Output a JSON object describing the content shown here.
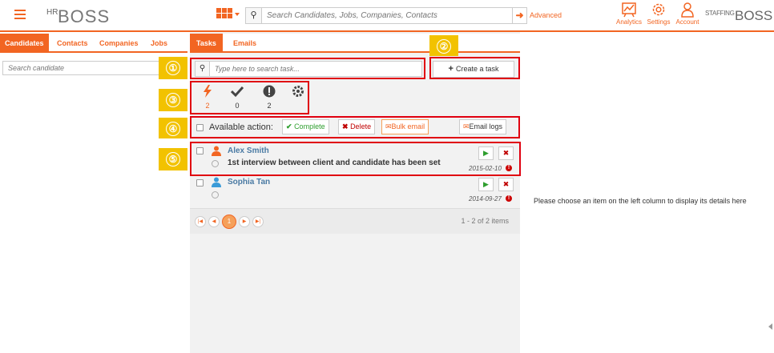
{
  "app": {
    "logo_hr": "HR",
    "logo_boss": "BOSS",
    "staffing_label": "STAFFING",
    "staffing_boss": "BOSS"
  },
  "topbar": {
    "search_placeholder": "Search Candidates, Jobs, Companies, Contacts",
    "advanced_label": "Advanced",
    "nav": [
      {
        "label": "Analytics",
        "icon": "analytics-icon"
      },
      {
        "label": "Settings",
        "icon": "gear-icon"
      },
      {
        "label": "Account",
        "icon": "user-icon"
      }
    ]
  },
  "left": {
    "tabs": [
      "Candidates",
      "Contacts",
      "Companies",
      "Jobs"
    ],
    "active_tab": "Candidates",
    "search_placeholder": "Search candidate"
  },
  "middle": {
    "tabs": [
      "Tasks",
      "Emails"
    ],
    "active_tab": "Tasks",
    "task_search_placeholder": "Type here to search task...",
    "create_task_label": "Create a task",
    "stats": [
      {
        "icon": "bolt-icon",
        "value": "2"
      },
      {
        "icon": "check-icon",
        "value": "0"
      },
      {
        "icon": "exclamation-icon",
        "value": "2"
      },
      {
        "icon": "gear-icon",
        "value": ""
      }
    ],
    "available_action_label": "Available action:",
    "actions": {
      "complete": "Complete",
      "delete": "Delete",
      "bulk_email": "Bulk email",
      "email_logs": "Email logs"
    },
    "tasks": [
      {
        "name": "Alex Smith",
        "description": "1st interview between client and candidate has been set",
        "date": "2015-02-10",
        "person_color": "#f26522"
      },
      {
        "name": "Sophia Tan",
        "description": "",
        "date": "2014-09-27",
        "person_color": "#3a9bd8"
      }
    ],
    "pager": {
      "current_page": "1",
      "info": "1 - 2 of 2 items"
    }
  },
  "right": {
    "placeholder_message": "Please choose an item on the left column to display its details here"
  },
  "annotations": [
    "①",
    "②",
    "③",
    "④",
    "⑤"
  ],
  "colors": {
    "accent": "#f26522",
    "annotation_border": "#e00010",
    "annotation_badge": "#f2c200",
    "link_blue": "#4a7aa3",
    "complete_green": "#2e9e2e",
    "delete_red": "#c00000"
  }
}
